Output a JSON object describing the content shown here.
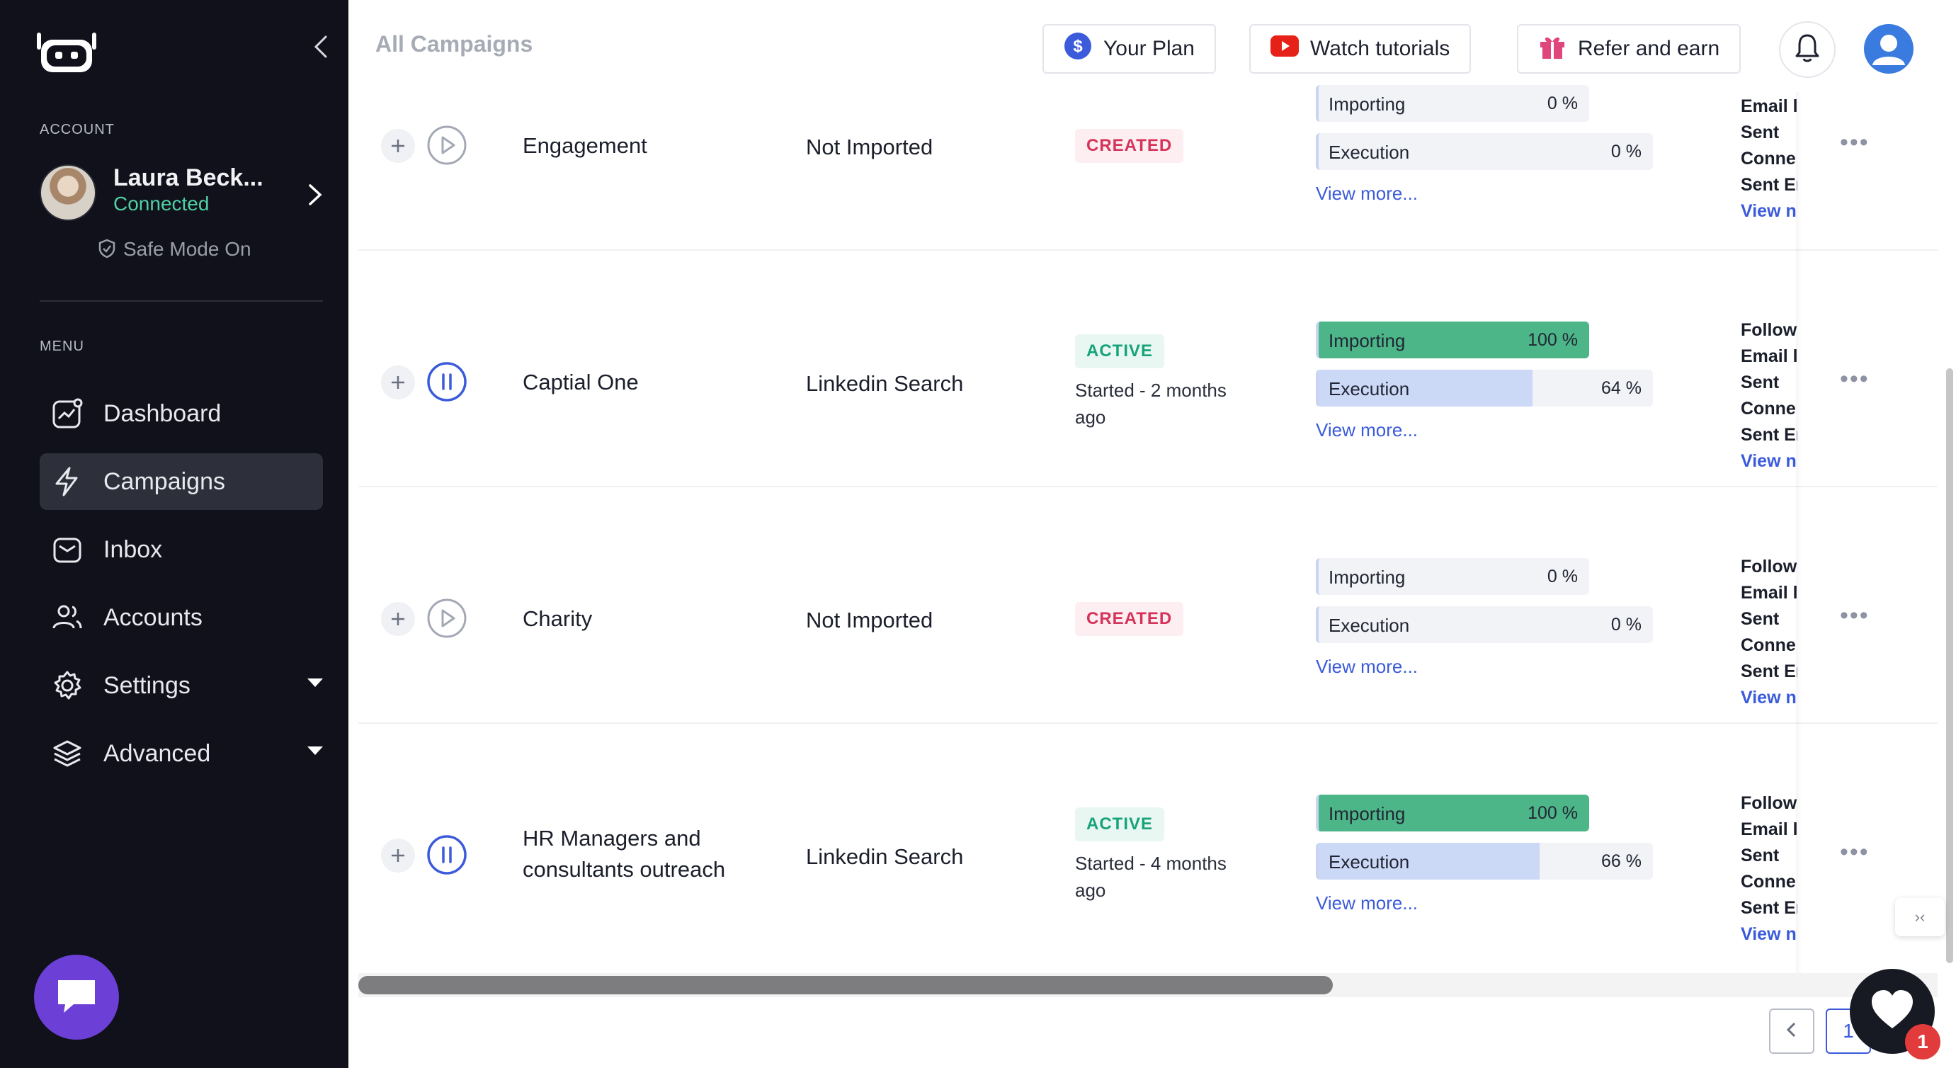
{
  "sidebar": {
    "account_label": "ACCOUNT",
    "account_name": "Laura Beck...",
    "account_status": "Connected",
    "safe_mode": "Safe Mode On",
    "menu_label": "MENU",
    "items": [
      {
        "label": "Dashboard",
        "icon": "dashboard-icon"
      },
      {
        "label": "Campaigns",
        "icon": "lightning-icon",
        "active": true
      },
      {
        "label": "Inbox",
        "icon": "inbox-icon"
      },
      {
        "label": "Accounts",
        "icon": "users-icon"
      },
      {
        "label": "Settings",
        "icon": "gear-icon"
      },
      {
        "label": "Advanced",
        "icon": "layers-icon"
      }
    ]
  },
  "header": {
    "title": "All Campaigns",
    "plan_label": "Your Plan",
    "tutorials_label": "Watch tutorials",
    "refer_label": "Refer and earn"
  },
  "campaigns": [
    {
      "name": "Engagement",
      "source": "Not Imported",
      "status": "CREATED",
      "started": "",
      "importing_label": "Importing",
      "importing_pct": "0 %",
      "execution_label": "Execution",
      "execution_pct": "0 %",
      "view_more": "View more...",
      "stats": [
        "Email l",
        "Sent",
        "Conne",
        "Sent Er",
        "View n"
      ]
    },
    {
      "name": "Captial One",
      "source": "Linkedin Search",
      "status": "ACTIVE",
      "started": "Started - 2 months ago",
      "importing_label": "Importing",
      "importing_pct": "100 %",
      "execution_label": "Execution",
      "execution_pct": "64 %",
      "view_more": "View more...",
      "stats": [
        "Follow",
        "Email l",
        "Sent",
        "Conne",
        "Sent Er",
        "View n"
      ]
    },
    {
      "name": "Charity",
      "source": "Not Imported",
      "status": "CREATED",
      "started": "",
      "importing_label": "Importing",
      "importing_pct": "0 %",
      "execution_label": "Execution",
      "execution_pct": "0 %",
      "view_more": "View more...",
      "stats": [
        "Follow",
        "Email l",
        "Sent",
        "Conne",
        "Sent Er",
        "View n"
      ]
    },
    {
      "name": "HR Managers and consultants outreach",
      "source": "Linkedin Search",
      "status": "ACTIVE",
      "started": "Started - 4 months ago",
      "importing_label": "Importing",
      "importing_pct": "100 %",
      "execution_label": "Execution",
      "execution_pct": "66 %",
      "view_more": "View more...",
      "stats": [
        "Follow",
        "Email l",
        "Sent",
        "Conne",
        "Sent Er",
        "View n"
      ]
    }
  ],
  "pagination": {
    "current": "1"
  },
  "support": {
    "badge_count": "1"
  },
  "colors": {
    "accent": "#3b5bdb",
    "success": "#4cb688",
    "danger": "#d6335a",
    "sidebar_bg": "#10111a"
  }
}
